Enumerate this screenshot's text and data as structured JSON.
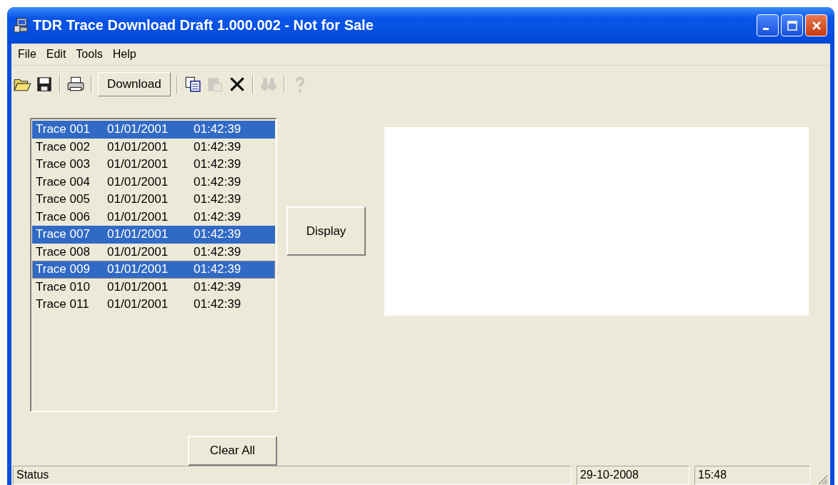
{
  "window": {
    "title": "TDR Trace Download Draft 1.000.002 - Not for Sale"
  },
  "menu": [
    "File",
    "Edit",
    "Tools",
    "Help"
  ],
  "toolbar": [
    [
      {
        "kind": "open",
        "disabled": false
      },
      {
        "kind": "save",
        "disabled": false
      }
    ],
    [
      {
        "kind": "print",
        "disabled": false
      }
    ],
    [
      {
        "kind": "button",
        "label": "Download",
        "disabled": false
      }
    ],
    [
      {
        "kind": "copy",
        "disabled": false
      },
      {
        "kind": "paste",
        "disabled": true
      },
      {
        "kind": "delete",
        "disabled": false
      }
    ],
    [
      {
        "kind": "find",
        "disabled": true
      }
    ],
    [
      {
        "kind": "help",
        "disabled": true
      }
    ]
  ],
  "traces": [
    {
      "name": "Trace 001",
      "date": "01/01/2001",
      "time": "01:42:39",
      "selected": true,
      "focused": false
    },
    {
      "name": "Trace 002",
      "date": "01/01/2001",
      "time": "01:42:39",
      "selected": false,
      "focused": false
    },
    {
      "name": "Trace 003",
      "date": "01/01/2001",
      "time": "01:42:39",
      "selected": false,
      "focused": false
    },
    {
      "name": "Trace 004",
      "date": "01/01/2001",
      "time": "01:42:39",
      "selected": false,
      "focused": false
    },
    {
      "name": "Trace 005",
      "date": "01/01/2001",
      "time": "01:42:39",
      "selected": false,
      "focused": false
    },
    {
      "name": "Trace 006",
      "date": "01/01/2001",
      "time": "01:42:39",
      "selected": false,
      "focused": false
    },
    {
      "name": "Trace 007",
      "date": "01/01/2001",
      "time": "01:42:39",
      "selected": true,
      "focused": false
    },
    {
      "name": "Trace 008",
      "date": "01/01/2001",
      "time": "01:42:39",
      "selected": false,
      "focused": false
    },
    {
      "name": "Trace 009",
      "date": "01/01/2001",
      "time": "01:42:39",
      "selected": true,
      "focused": true
    },
    {
      "name": "Trace 010",
      "date": "01/01/2001",
      "time": "01:42:39",
      "selected": false,
      "focused": false
    },
    {
      "name": "Trace 011",
      "date": "01/01/2001",
      "time": "01:42:39",
      "selected": false,
      "focused": false
    }
  ],
  "display_button": "Display",
  "clear_button": "Clear All",
  "status_bar": {
    "status": "Status",
    "date": "29-10-2008",
    "time": "15:48"
  }
}
